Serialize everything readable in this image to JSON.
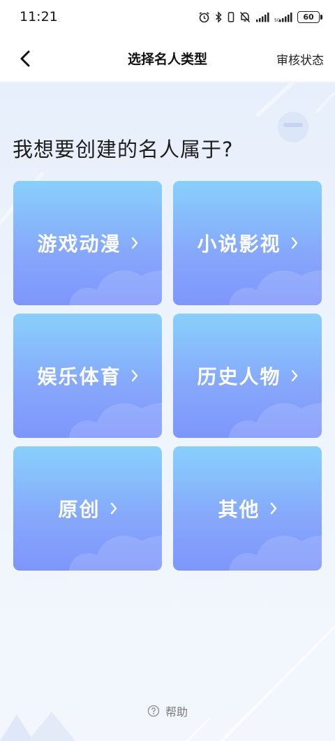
{
  "status_bar": {
    "time": "11:21",
    "battery": "60",
    "icons": [
      "alarm-icon",
      "bluetooth-icon",
      "mute-icon",
      "signal-icon",
      "signal-icon",
      "battery-icon"
    ]
  },
  "nav": {
    "title": "选择名人类型",
    "action_label": "审核状态",
    "back_icon": "chevron-left-icon"
  },
  "main": {
    "question": "我想要创建的名人属于?",
    "categories": [
      {
        "label": "游戏动漫"
      },
      {
        "label": "小说影视"
      },
      {
        "label": "娱乐体育"
      },
      {
        "label": "历史人物"
      },
      {
        "label": "原创"
      },
      {
        "label": "其他"
      }
    ],
    "card_gradient": [
      "#88d0fb",
      "#7e96fb"
    ]
  },
  "help": {
    "label": "帮助",
    "icon": "question-circle-icon"
  }
}
